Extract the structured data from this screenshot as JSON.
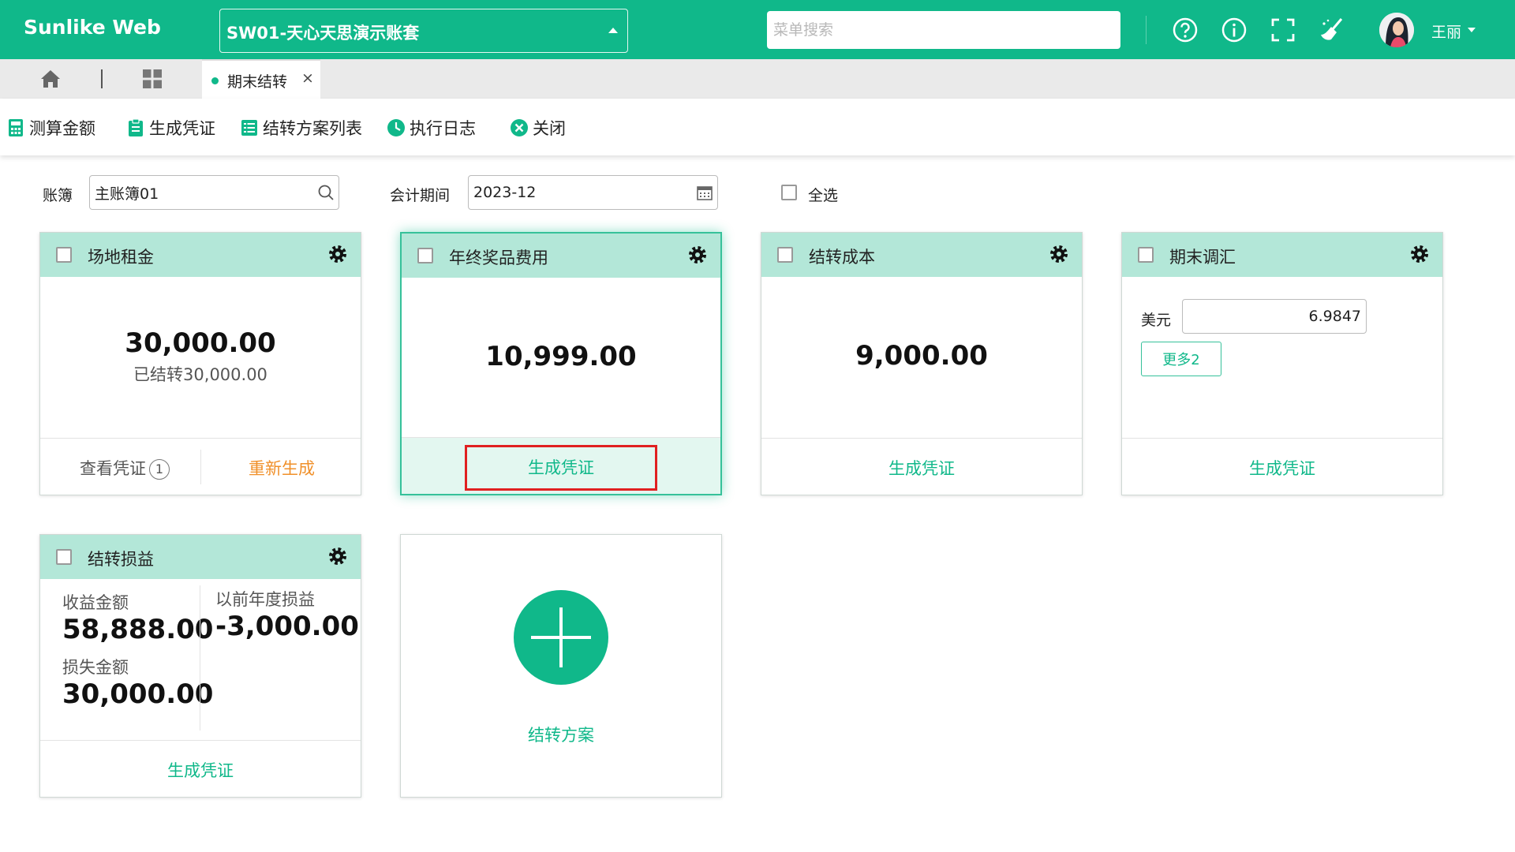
{
  "header": {
    "brand": "Sunlike Web",
    "account_book": "SW01-天心天思演示账套",
    "search_placeholder": "菜单搜索",
    "username": "王丽"
  },
  "tabs": {
    "active_label": "期末结转",
    "close_glyph": "×"
  },
  "toolbar": {
    "calc_label": "测算金额",
    "voucher_label": "生成凭证",
    "plan_list_label": "结转方案列表",
    "log_label": "执行日志",
    "close_label": "关闭"
  },
  "filters": {
    "ledger_label": "账簿",
    "ledger_value": "主账簿01",
    "period_label": "会计期间",
    "period_value": "2023-12",
    "select_all_label": "全选"
  },
  "cards": {
    "rent": {
      "title": "场地租金",
      "amount": "30,000.00",
      "carried": "已结转30,000.00",
      "view_voucher": "查看凭证",
      "voucher_count": "1",
      "regenerate": "重新生成"
    },
    "bonus": {
      "title": "年终奖品费用",
      "amount": "10,999.00",
      "action": "生成凭证"
    },
    "cost": {
      "title": "结转成本",
      "amount": "9,000.00",
      "action": "生成凭证"
    },
    "fx": {
      "title": "期末调汇",
      "currency": "美元",
      "rate": "6.9847",
      "more": "更多2",
      "action": "生成凭证"
    },
    "pl": {
      "title": "结转损益",
      "income_label": "收益金额",
      "income_value": "58,888.00",
      "loss_label": "损失金额",
      "loss_value": "30,000.00",
      "prior_label": "以前年度损益",
      "prior_value": "-3,000.00",
      "action": "生成凭证"
    },
    "add": {
      "label": "结转方案"
    }
  },
  "colors": {
    "brand": "#10b88a",
    "card_header": "#b3e7d8",
    "regenerate": "#f0902a",
    "highlight": "#e02020"
  }
}
